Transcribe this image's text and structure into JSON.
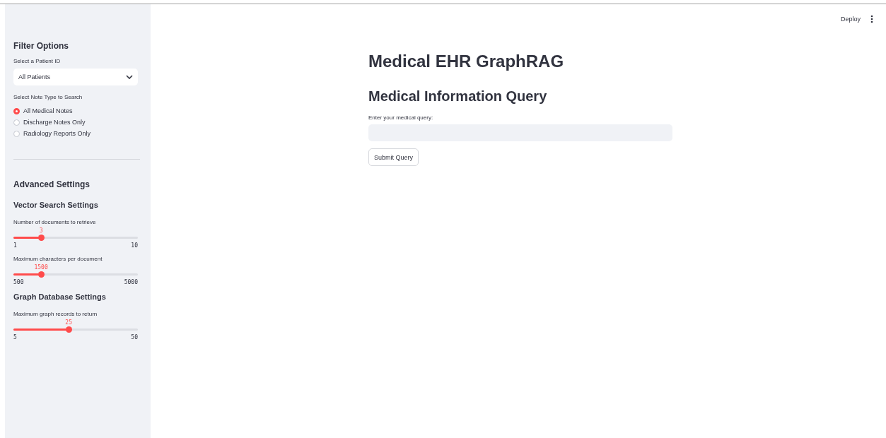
{
  "header": {
    "deploy": "Deploy"
  },
  "sidebar": {
    "title": "Filter Options",
    "patient_label": "Select a Patient ID",
    "patient_value": "All Patients",
    "note_label": "Select Note Type to Search",
    "note_types": [
      {
        "label": "All Medical Notes",
        "selected": true
      },
      {
        "label": "Discharge Notes Only",
        "selected": false
      },
      {
        "label": "Radiology Reports Only",
        "selected": false
      }
    ],
    "advanced_title": "Advanced Settings",
    "sections": [
      {
        "title": "Vector Search Settings",
        "sliders": [
          {
            "label": "Number of documents to retrieve",
            "value": "3",
            "min": "1",
            "max": "10",
            "level": 0.222
          },
          {
            "label": "Maximum characters per document",
            "value": "1500",
            "min": "500",
            "max": "5000",
            "level": 0.222
          }
        ]
      },
      {
        "title": "Graph Database Settings",
        "sliders": [
          {
            "label": "Maximum graph records to return",
            "value": "25",
            "min": "5",
            "max": "50",
            "level": 0.444
          }
        ]
      }
    ]
  },
  "main": {
    "title": "Medical EHR GraphRAG",
    "subtitle": "Medical Information Query",
    "query_label": "Enter your medical query:",
    "submit": "Submit Query"
  }
}
